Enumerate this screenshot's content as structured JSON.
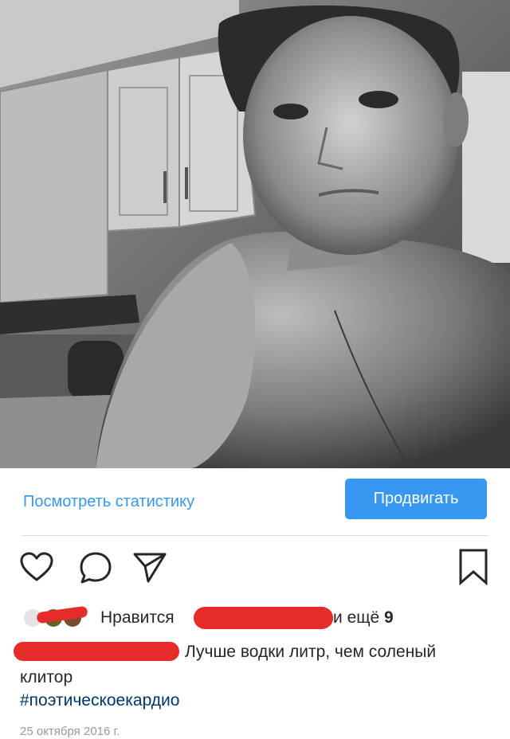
{
  "post": {
    "photo_icon": "selfie-photo"
  },
  "stats_bar": {
    "view_stats_label": "Посмотреть статистику",
    "promote_label": "Продвигать"
  },
  "actions": {
    "like_icon": "heart-icon",
    "comment_icon": "comment-icon",
    "share_icon": "paper-plane-icon",
    "save_icon": "bookmark-icon"
  },
  "likes": {
    "prefix": "Нравится",
    "suffix_text": "и ещё ",
    "count": "9"
  },
  "caption": {
    "text_line1": "Лучше водки литр, чем соленый",
    "text_line2": "клитор",
    "hashtag": "#поэтическоекардио"
  },
  "date": "25 октября 2016 г.",
  "colors": {
    "accent": "#3897f0",
    "hashtag": "#003569",
    "redaction": "#e62b2b",
    "text": "#262626",
    "muted": "#999999"
  }
}
